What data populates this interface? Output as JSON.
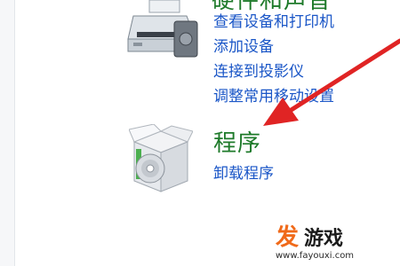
{
  "hardware_section": {
    "title": "硬件和声音",
    "links": [
      "查看设备和打印机",
      "添加设备",
      "连接到投影仪",
      "调整常用移动设置"
    ]
  },
  "programs_section": {
    "title": "程序",
    "links": [
      "卸载程序"
    ]
  },
  "watermark": {
    "text": "游戏",
    "url": "www.fayouxi.com"
  },
  "colors": {
    "section_title": "#1e7a2a",
    "link": "#1a56c7",
    "arrow": "#e02424",
    "watermark_accent": "#f06a1a"
  },
  "icons": [
    "printer-icon",
    "programs-box-icon",
    "red-arrow"
  ]
}
